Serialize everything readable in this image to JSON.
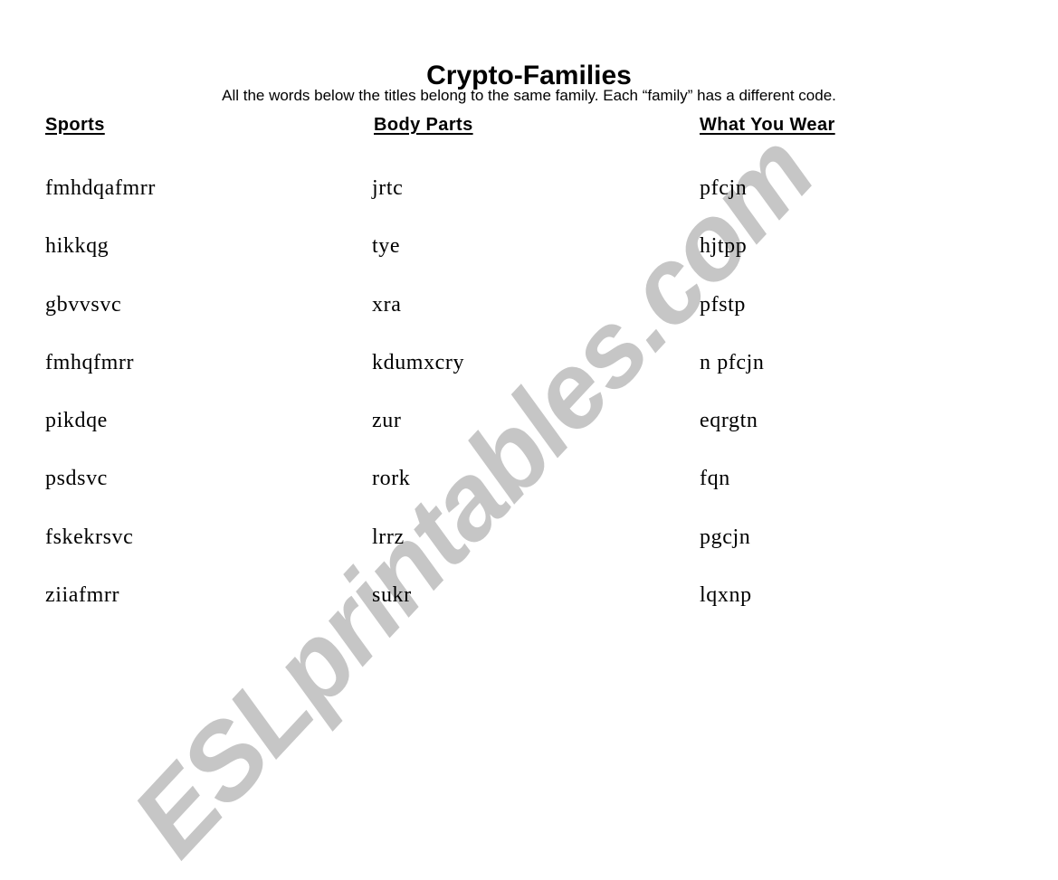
{
  "document": {
    "title": "Crypto-Families",
    "instructions": "All the words below the titles belong to the same family.  Each “family” has a different code.",
    "watermark": "ESLprintables.com"
  },
  "columns": [
    {
      "heading": "Sports",
      "words": [
        "fmhdqafmrr",
        "hikkqg",
        "gbvvsvc",
        "fmhqfmrr",
        "pikdqe",
        "psdsvc",
        "fskekrsvc",
        "ziiafmrr"
      ]
    },
    {
      "heading": "Body Parts",
      "words": [
        "jrtc",
        "tye",
        "xra",
        "kdumxcry",
        "zur",
        "rork",
        "lrrz",
        "sukr"
      ]
    },
    {
      "heading": "What You Wear",
      "words": [
        "pfcjn",
        "hjtpp",
        "pfstp",
        "n pfcjn",
        "eqrgtn",
        "fqn",
        "pgcjn",
        "lqxnp"
      ]
    }
  ]
}
